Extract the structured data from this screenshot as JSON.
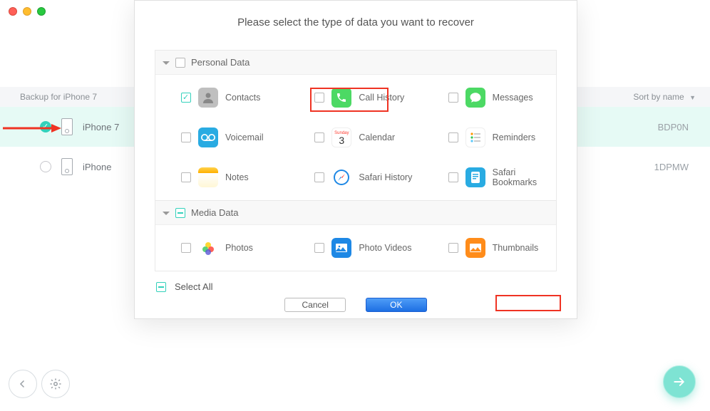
{
  "topbar": {
    "backup_label": "Backup for iPhone 7",
    "sort_label": "Sort by name"
  },
  "devices": [
    {
      "name": "iPhone 7",
      "selected": true,
      "serial_suffix": "BDP0N"
    },
    {
      "name": "iPhone",
      "selected": false,
      "serial_suffix": "1DPMW"
    }
  ],
  "modal": {
    "title": "Please select the type of data you want to recover",
    "personal_label": "Personal Data",
    "media_label": "Media Data",
    "select_all": "Select All",
    "cancel": "Cancel",
    "ok": "OK"
  },
  "personal_items": {
    "contacts": "Contacts",
    "call_history": "Call History",
    "messages": "Messages",
    "voicemail": "Voicemail",
    "calendar": "Calendar",
    "reminders": "Reminders",
    "notes": "Notes",
    "safari_history": "Safari History",
    "safari_bookmarks": "Safari Bookmarks"
  },
  "media_items": {
    "photos": "Photos",
    "photo_videos": "Photo Videos",
    "thumbnails": "Thumbnails"
  },
  "calendar_day": "3"
}
